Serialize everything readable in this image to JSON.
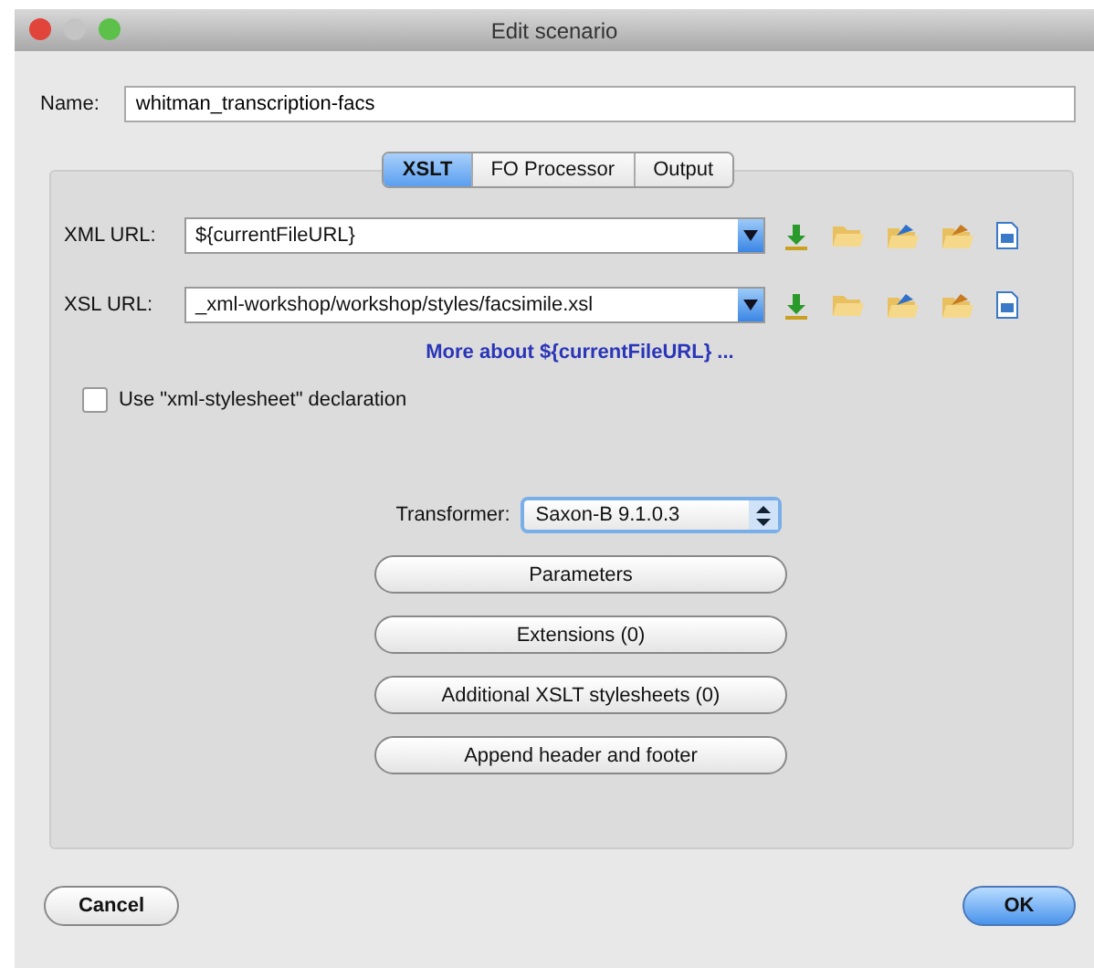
{
  "window": {
    "title": "Edit scenario"
  },
  "name_field": {
    "label": "Name:",
    "value": "whitman_transcription-facs"
  },
  "tabs": [
    {
      "label": "XSLT",
      "selected": true
    },
    {
      "label": "FO Processor",
      "selected": false
    },
    {
      "label": "Output",
      "selected": false
    }
  ],
  "url_rows": [
    {
      "label": "XML URL:",
      "value": "${currentFileURL}"
    },
    {
      "label": "XSL URL:",
      "value": "_xml-workshop/workshop/styles/facsimile.xsl"
    }
  ],
  "link": "More about ${currentFileURL} ...",
  "checkbox": {
    "label": "Use \"xml-stylesheet\" declaration",
    "checked": false
  },
  "transformer": {
    "label": "Transformer:",
    "value": "Saxon-B 9.1.0.3"
  },
  "buttons": [
    "Parameters",
    "Extensions (0)",
    "Additional XSLT stylesheets (0)",
    "Append header and footer"
  ],
  "footer_buttons": [
    {
      "label": "Cancel",
      "default": false
    },
    {
      "label": "OK",
      "default": true
    }
  ]
}
